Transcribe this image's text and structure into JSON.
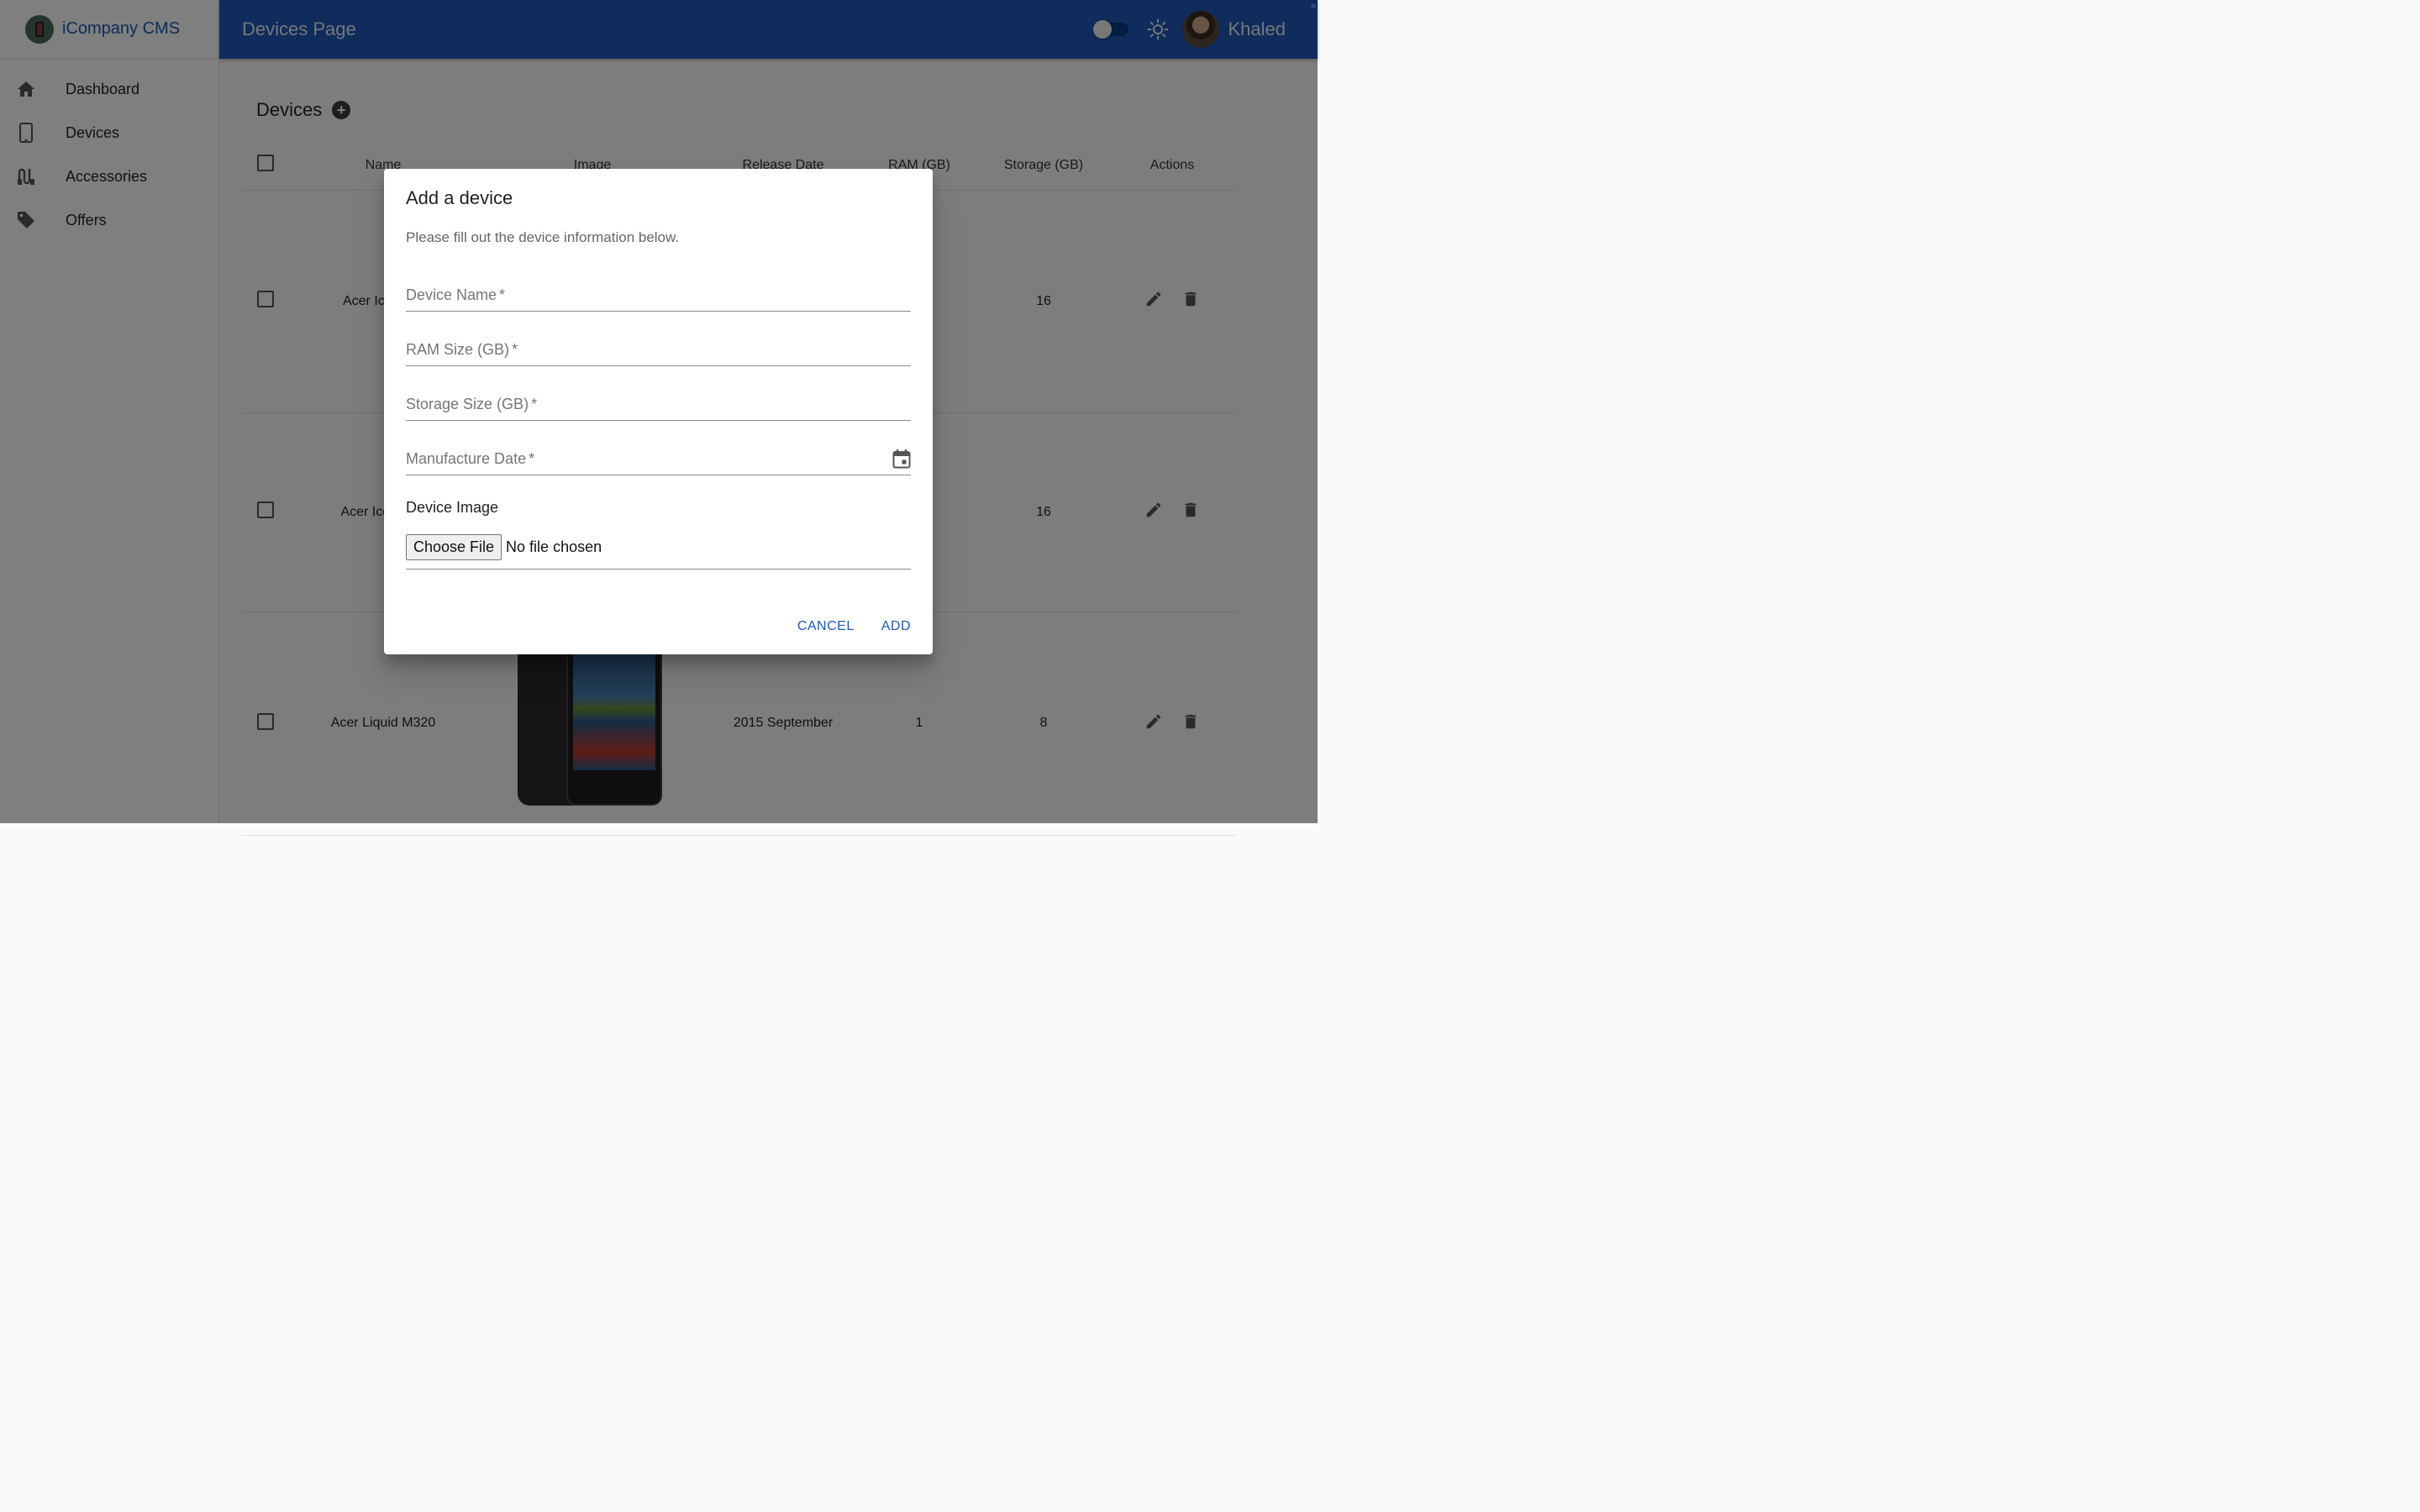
{
  "colors": {
    "primary": "#1e58b8",
    "sidebar_bg": "#ffffff",
    "overlay": "rgba(0,0,0,0.5)"
  },
  "brand": {
    "name": "iCompany CMS",
    "logo_icon": "phone-logo-icon"
  },
  "sidebar": {
    "items": [
      {
        "label": "Dashboard",
        "icon": "home-icon"
      },
      {
        "label": "Devices",
        "icon": "smartphone-icon"
      },
      {
        "label": "Accessories",
        "icon": "accessories-icon"
      },
      {
        "label": "Offers",
        "icon": "tag-icon"
      }
    ]
  },
  "header": {
    "title": "Devices Page",
    "user_name": "Khaled"
  },
  "main": {
    "title": "Devices"
  },
  "table": {
    "headers": {
      "name": "Name",
      "image": "Image",
      "release_date": "Release Date",
      "ram": "RAM (GB)",
      "storage": "Storage (GB)",
      "actions": "Actions"
    },
    "rows": [
      {
        "name": "Acer Iconia C",
        "release_date": "",
        "ram": "",
        "storage": "16"
      },
      {
        "name": "Acer Iconia Ta",
        "release_date": "",
        "ram": "",
        "storage": "16"
      },
      {
        "name": "Acer Liquid M320",
        "release_date": "2015 September",
        "ram": "1",
        "storage": "8"
      }
    ]
  },
  "dialog": {
    "title": "Add a device",
    "description": "Please fill out the device information below.",
    "fields": {
      "device_name": {
        "label": "Device Name",
        "required": "*",
        "value": ""
      },
      "ram_size": {
        "label": "RAM Size (GB)",
        "required": "*",
        "value": ""
      },
      "storage_size": {
        "label": "Storage Size (GB)",
        "required": "*",
        "value": ""
      },
      "manufacture_date": {
        "label": "Manufacture Date",
        "required": "*",
        "value": ""
      }
    },
    "image_label": "Device Image",
    "choose_file": "Choose File",
    "no_file": "No file chosen",
    "cancel": "CANCEL",
    "add": "ADD"
  }
}
